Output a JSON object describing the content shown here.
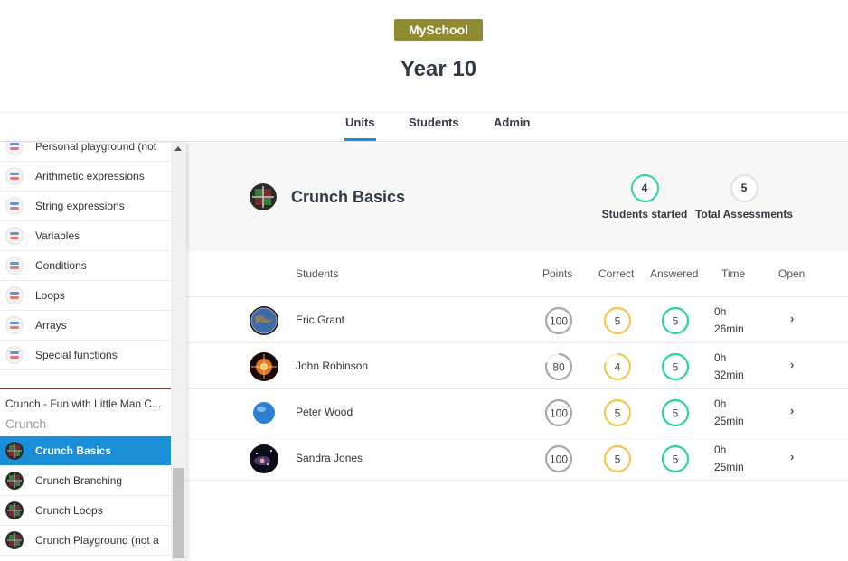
{
  "app": {
    "brand": "MySchool",
    "title": "Year 10"
  },
  "tabs": [
    {
      "label": "Units",
      "active": true
    },
    {
      "label": "Students",
      "active": false
    },
    {
      "label": "Admin",
      "active": false
    }
  ],
  "sidebar": {
    "items": [
      {
        "label": "Personal playground (not",
        "icon": "python-unit-icon"
      },
      {
        "label": "Arithmetic expressions",
        "icon": "python-unit-icon"
      },
      {
        "label": "String expressions",
        "icon": "python-unit-icon"
      },
      {
        "label": "Variables",
        "icon": "python-unit-icon"
      },
      {
        "label": "Conditions",
        "icon": "python-unit-icon"
      },
      {
        "label": "Loops",
        "icon": "python-unit-icon"
      },
      {
        "label": "Arrays",
        "icon": "python-unit-icon"
      },
      {
        "label": "Special functions",
        "icon": "python-unit-icon"
      }
    ],
    "course_title": "Crunch - Fun with Little Man C...",
    "course_subtitle": "Crunch",
    "course_items": [
      {
        "label": "Crunch Basics",
        "icon": "crunch-unit-icon",
        "active": true
      },
      {
        "label": "Crunch Branching",
        "icon": "crunch-unit-icon",
        "active": false
      },
      {
        "label": "Crunch Loops",
        "icon": "crunch-unit-icon",
        "active": false
      },
      {
        "label": "Crunch Playground (not a",
        "icon": "crunch-unit-icon",
        "active": false
      }
    ]
  },
  "unit": {
    "title": "Crunch Basics",
    "icon": "crunch-unit-icon",
    "students_started": "4",
    "students_started_label": "Students started",
    "total_assessments": "5",
    "total_assessments_label": "Total Assessments"
  },
  "table": {
    "headers": {
      "students": "Students",
      "points": "Points",
      "correct": "Correct",
      "answered": "Answered",
      "time": "Time",
      "open": "Open"
    },
    "rows": [
      {
        "name": "Eric Grant",
        "avatar": "earth-avatar-icon",
        "points": "100",
        "points_fraction": 1.0,
        "correct": "5",
        "correct_fraction": 1.0,
        "answered": "5",
        "answered_fraction": 1.0,
        "time_h": "0h",
        "time_m": "26min"
      },
      {
        "name": "John Robinson",
        "avatar": "sun-avatar-icon",
        "points": "80",
        "points_fraction": 0.8,
        "correct": "4",
        "correct_fraction": 0.8,
        "answered": "5",
        "answered_fraction": 1.0,
        "time_h": "0h",
        "time_m": "32min"
      },
      {
        "name": "Peter Wood",
        "avatar": "planet-avatar-icon",
        "points": "100",
        "points_fraction": 1.0,
        "correct": "5",
        "correct_fraction": 1.0,
        "answered": "5",
        "answered_fraction": 1.0,
        "time_h": "0h",
        "time_m": "25min"
      },
      {
        "name": "Sandra Jones",
        "avatar": "galaxy-avatar-icon",
        "points": "100",
        "points_fraction": 1.0,
        "correct": "5",
        "correct_fraction": 1.0,
        "answered": "5",
        "answered_fraction": 1.0,
        "time_h": "0h",
        "time_m": "25min"
      }
    ],
    "open_glyph": "›"
  },
  "colors": {
    "brand": "#8f8b33",
    "accent": "#1a8ed6",
    "points_ring": "#a4aab3",
    "correct_ring": "#f3c752",
    "answered_ring": "#2ed3a0",
    "started_ring": "#2ed3a0",
    "assessments_ring": "#e2e2e2"
  }
}
